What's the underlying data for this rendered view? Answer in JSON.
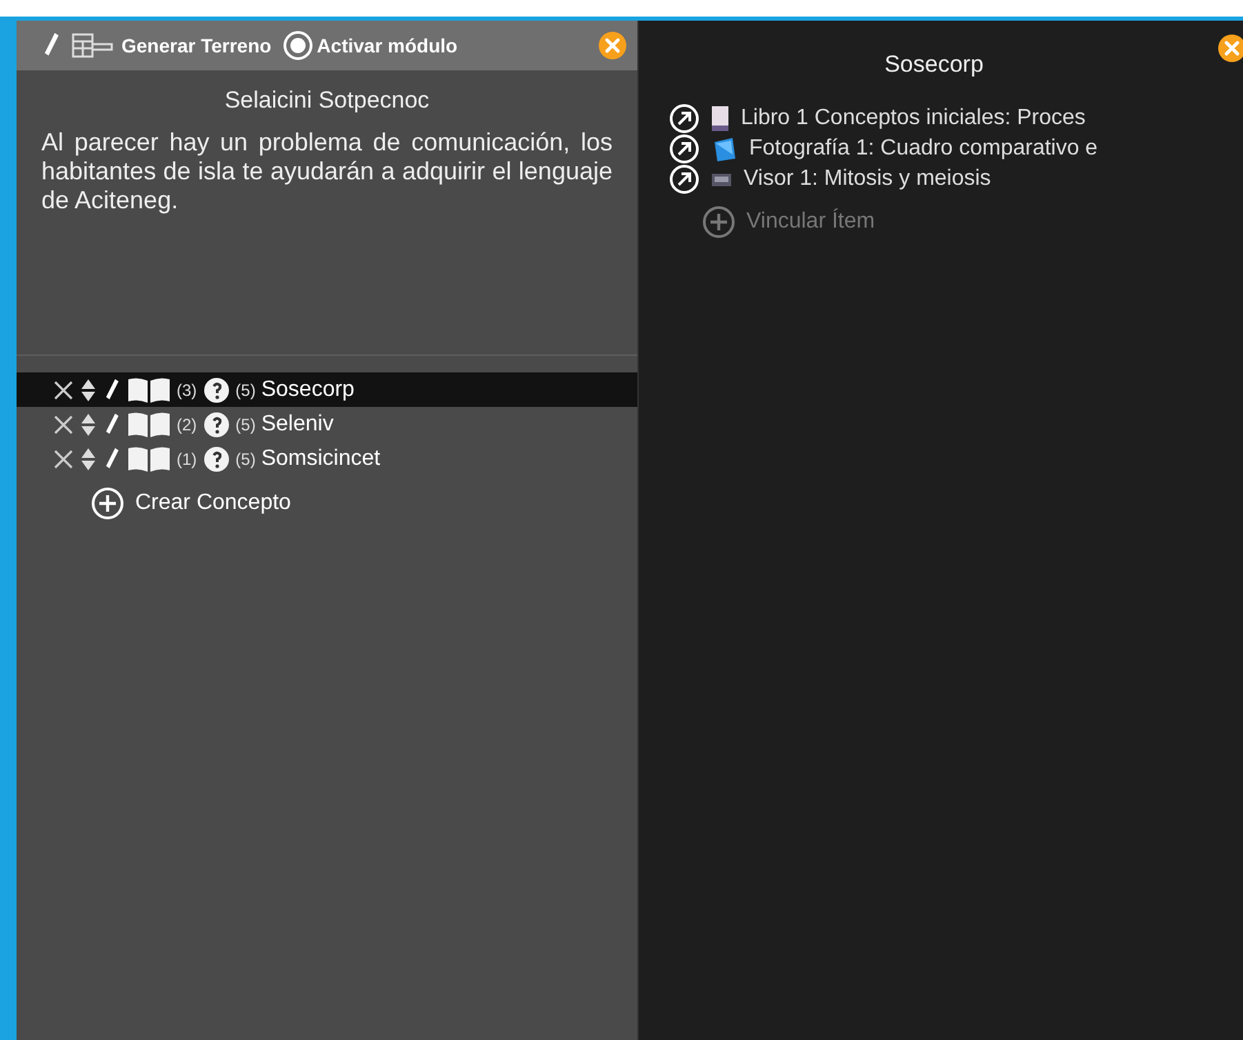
{
  "toolbar": {
    "generate_label": "Generar Terreno",
    "activate": {
      "label": "Activar módulo",
      "on": true
    }
  },
  "module": {
    "title": "Selaicini Sotpecnoc",
    "description": "Al parecer hay un problema de comunicación, los habitantes de isla te ayudarán a adquirir el lenguaje de Aciteneg."
  },
  "concepts": [
    {
      "name": "Sosecorp",
      "count_a": "(3)",
      "count_b": "(5)",
      "selected": true
    },
    {
      "name": "Seleniv",
      "count_a": "(2)",
      "count_b": "(5)",
      "selected": false
    },
    {
      "name": "Somsicincet",
      "count_a": "(1)",
      "count_b": "(5)",
      "selected": false
    }
  ],
  "create_concept": "Crear Concepto",
  "detail": {
    "title": "Sosecorp",
    "items": [
      {
        "kind": "book",
        "label": "Libro 1 Conceptos iniciales: Proces"
      },
      {
        "kind": "photo",
        "label": "Fotografía 1: Cuadro comparativo e"
      },
      {
        "kind": "viewer",
        "label": "Visor 1: Mitosis y meiosis"
      }
    ],
    "link_item": "Vincular Ítem"
  }
}
